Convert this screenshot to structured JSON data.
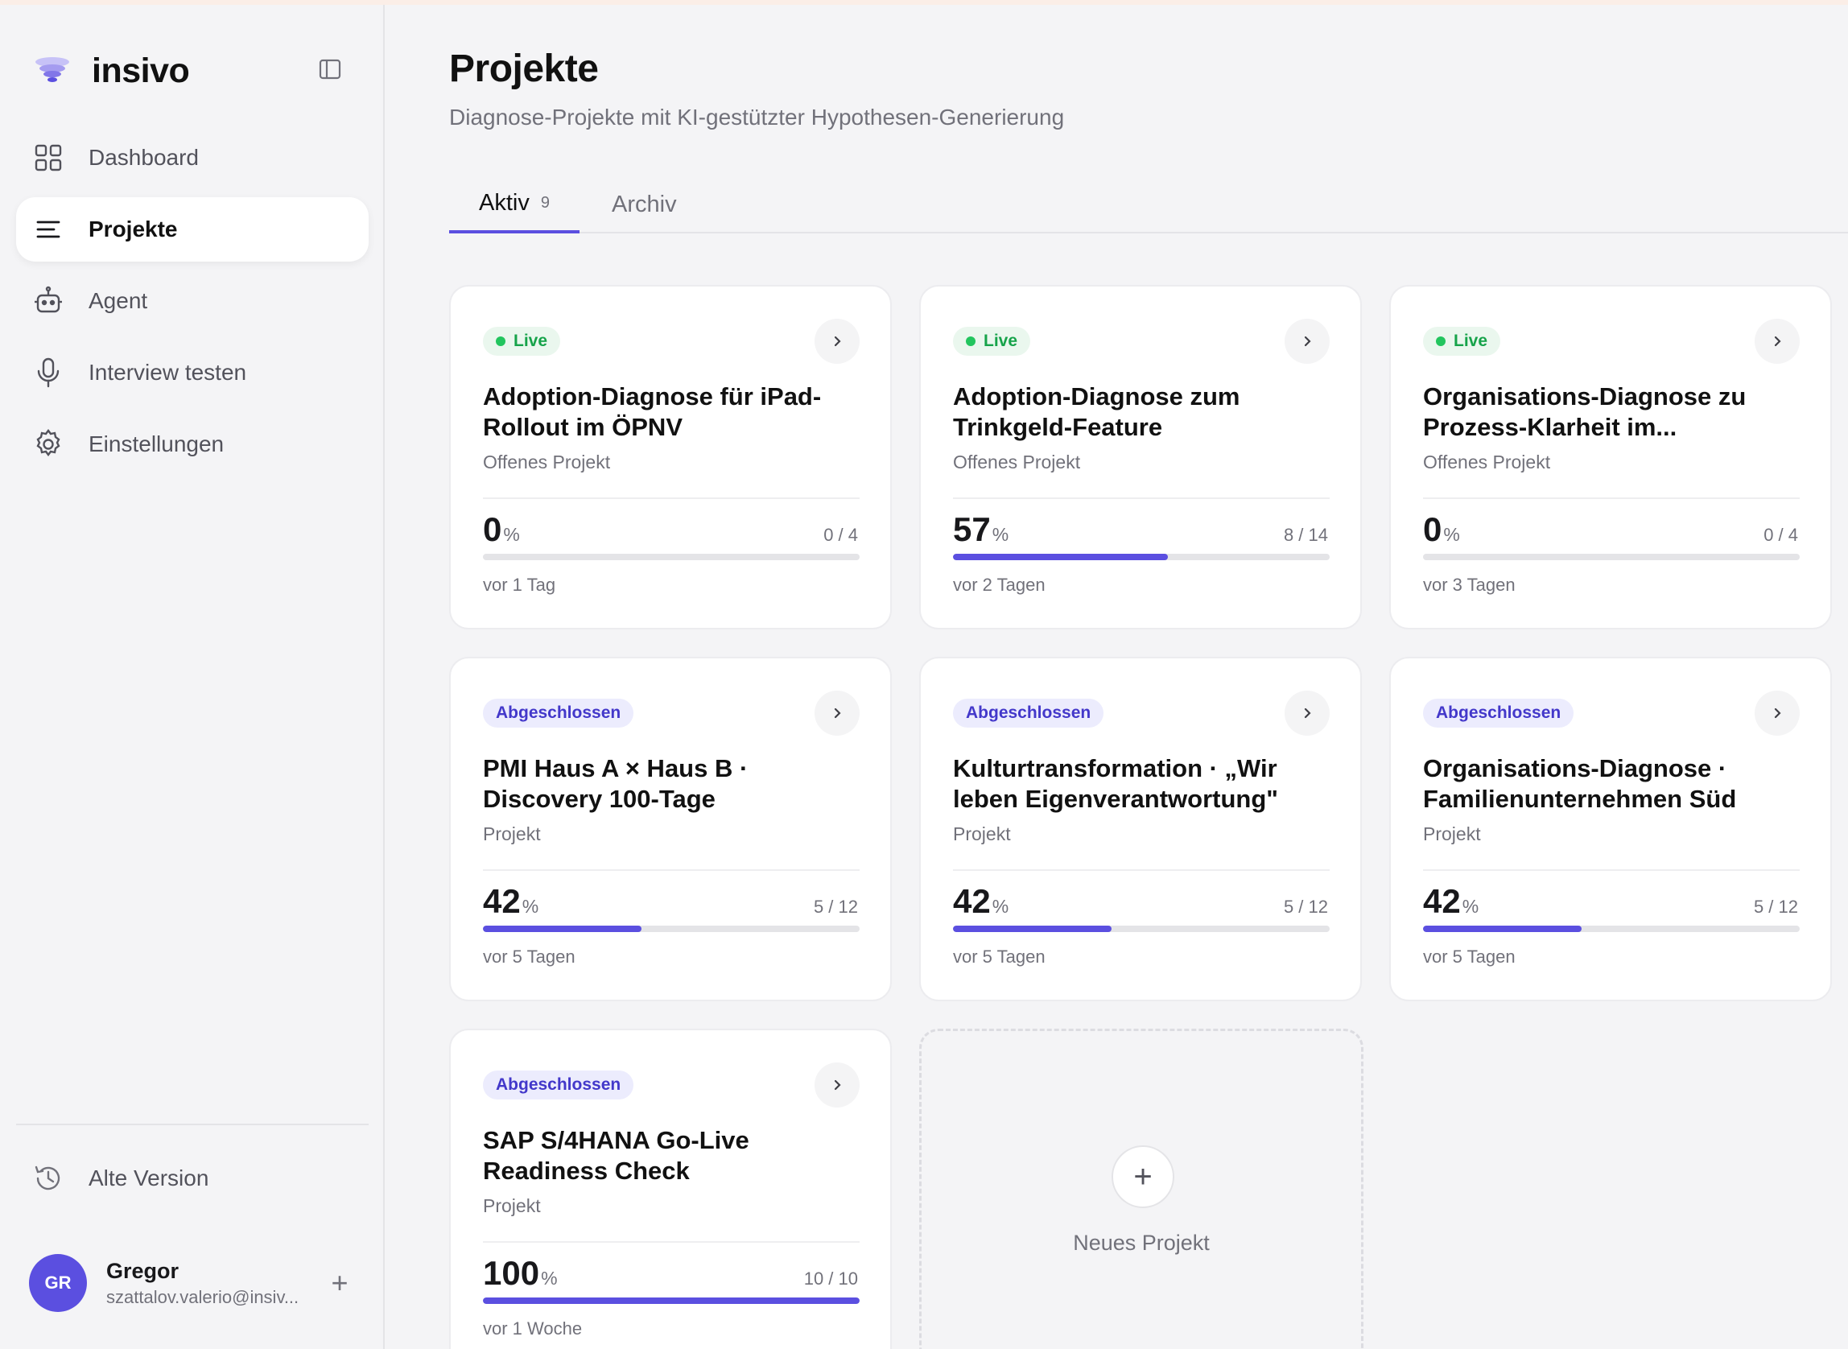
{
  "brand": {
    "name": "insivo"
  },
  "sidebar": {
    "items": [
      {
        "label": "Dashboard",
        "icon": "grid-icon",
        "active": false
      },
      {
        "label": "Projekte",
        "icon": "list-icon",
        "active": true
      },
      {
        "label": "Agent",
        "icon": "robot-icon",
        "active": false
      },
      {
        "label": "Interview testen",
        "icon": "microphone-icon",
        "active": false
      },
      {
        "label": "Einstellungen",
        "icon": "gear-icon",
        "active": false
      }
    ],
    "old_version": "Alte Version",
    "user": {
      "initials": "GR",
      "name": "Gregor",
      "email": "szattalov.valerio@insiv..."
    }
  },
  "header": {
    "title": "Projekte",
    "subtitle": "Diagnose-Projekte mit KI-gestützter Hypothesen-Generierung"
  },
  "tabs": [
    {
      "label": "Aktiv",
      "count": "9",
      "active": true
    },
    {
      "label": "Archiv",
      "active": false
    }
  ],
  "colors": {
    "accent": "#5b4fe0",
    "live": "#16a34a",
    "done": "#4338ca"
  },
  "projects": [
    {
      "status": "Live",
      "status_type": "live",
      "title": "Adoption-Diagnose für iPad-Rollout im ÖPNV",
      "type": "Offenes Projekt",
      "percent": "0",
      "ratio": "0 / 4",
      "progress": 0,
      "updated": "vor 1 Tag"
    },
    {
      "status": "Live",
      "status_type": "live",
      "title": "Adoption-Diagnose zum Trinkgeld-Feature",
      "type": "Offenes Projekt",
      "percent": "57",
      "ratio": "8 / 14",
      "progress": 0.57,
      "updated": "vor 2 Tagen"
    },
    {
      "status": "Live",
      "status_type": "live",
      "title": "Organisations-Diagnose zu Prozess-Klarheit im...",
      "type": "Offenes Projekt",
      "percent": "0",
      "ratio": "0 / 4",
      "progress": 0,
      "updated": "vor 3 Tagen"
    },
    {
      "status": "Abgeschlossen",
      "status_type": "done",
      "title": "PMI Haus A × Haus B · Discovery 100-Tage",
      "type": "Projekt",
      "percent": "42",
      "ratio": "5 / 12",
      "progress": 0.42,
      "updated": "vor 5 Tagen"
    },
    {
      "status": "Abgeschlossen",
      "status_type": "done",
      "title": "Kulturtransformation · „Wir leben Eigenverantwortung\"",
      "type": "Projekt",
      "percent": "42",
      "ratio": "5 / 12",
      "progress": 0.42,
      "updated": "vor 5 Tagen"
    },
    {
      "status": "Abgeschlossen",
      "status_type": "done",
      "title": "Organisations-Diagnose · Familienunternehmen Süd",
      "type": "Projekt",
      "percent": "42",
      "ratio": "5 / 12",
      "progress": 0.42,
      "updated": "vor 5 Tagen"
    },
    {
      "status": "Abgeschlossen",
      "status_type": "done",
      "title": "SAP S/4HANA Go-Live Readiness Check",
      "type": "Projekt",
      "percent": "100",
      "ratio": "10 / 10",
      "progress": 1,
      "updated": "vor 1 Woche"
    }
  ],
  "new_project": {
    "label": "Neues Projekt"
  }
}
